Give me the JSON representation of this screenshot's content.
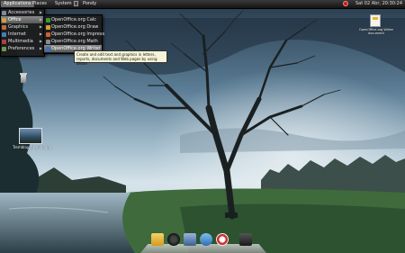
{
  "panel": {
    "applications": "Applications",
    "places": "Places",
    "system": "System",
    "user_text": "Pondy",
    "clock": "Sat 02 Abr, 20:30:24"
  },
  "applications_menu": [
    {
      "label": "Accessories",
      "icon": "accessories-icon",
      "color": "#7a8aa0"
    },
    {
      "label": "Office",
      "icon": "office-icon",
      "color": "#d0a040",
      "highlighted": true
    },
    {
      "label": "Graphics",
      "icon": "graphics-icon",
      "color": "#c06a40"
    },
    {
      "label": "Internet",
      "icon": "internet-icon",
      "color": "#3f7fc0"
    },
    {
      "label": "Multimedia",
      "icon": "multimedia-icon",
      "color": "#b04040"
    },
    {
      "label": "Preferences",
      "icon": "preferences-icon",
      "color": "#6a9a50"
    }
  ],
  "office_menu": [
    {
      "label": "OpenOffice.org Calc",
      "icon": "calc-icon",
      "color": "#3a9a3a"
    },
    {
      "label": "OpenOffice.org Draw",
      "icon": "draw-icon",
      "color": "#d0a030"
    },
    {
      "label": "OpenOffice.org Impress",
      "icon": "impress-icon",
      "color": "#d06030"
    },
    {
      "label": "OpenOffice.org Math",
      "icon": "math-icon",
      "color": "#8a8a8a"
    },
    {
      "label": "OpenOffice.org Writer",
      "icon": "writer-icon",
      "color": "#3a70c0",
      "highlighted": true
    }
  ],
  "tooltip": [
    "Create and edit text and graphics in letters,",
    "reports, documents and Web pages by using Writer"
  ],
  "desktop": {
    "trash_icon": "trash-icon",
    "photo_label": "Tremblay_ah_hida.jpg",
    "doc_label": "OpenOffice.org Writer document"
  },
  "dock": [
    "notes-icon",
    "media-icon",
    "files-icon",
    "player-icon",
    "browser-icon",
    "terminal-icon"
  ],
  "colors": {
    "panel": "#1e1e1e",
    "menu_bg": "#1c1c1c",
    "highlight": "#7a7a7a",
    "tooltip_bg": "#f4f4d8"
  }
}
